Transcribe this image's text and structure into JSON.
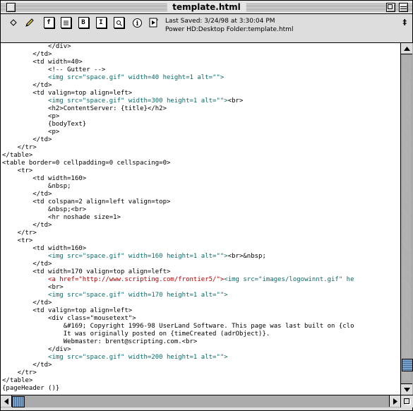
{
  "window": {
    "title": "template.html"
  },
  "toolbar": {
    "icons": [
      "diamond-icon",
      "pencil-icon",
      "function-icon",
      "list-icon",
      "bookmark-icon",
      "indent-icon",
      "find-icon",
      "info-icon",
      "compile-icon"
    ],
    "last_saved": "Last Saved: 3/24/98 at 3:30:04 PM",
    "file_path": "Power HD:Desktop Folder:template.html",
    "right_icon_glyph": "‡"
  },
  "editor": {
    "lines": [
      {
        "segments": [
          {
            "t": "            </div>",
            "c": ""
          }
        ]
      },
      {
        "segments": [
          {
            "t": "        </td>",
            "c": ""
          }
        ]
      },
      {
        "segments": [
          {
            "t": "        <td width=40>",
            "c": ""
          }
        ]
      },
      {
        "segments": [
          {
            "t": "            <!-- Gutter -->",
            "c": ""
          }
        ]
      },
      {
        "segments": [
          {
            "t": "            ",
            "c": ""
          },
          {
            "t": "<img src=\"space.gif\" width=40 height=1 alt=\"\">",
            "c": "teal"
          }
        ]
      },
      {
        "segments": [
          {
            "t": "        </td>",
            "c": ""
          }
        ]
      },
      {
        "segments": [
          {
            "t": "        <td valign=top align=left>",
            "c": ""
          }
        ]
      },
      {
        "segments": [
          {
            "t": "            ",
            "c": ""
          },
          {
            "t": "<img src=\"space.gif\" width=300 height=1 alt=\"\">",
            "c": "teal"
          },
          {
            "t": "<br>",
            "c": ""
          }
        ]
      },
      {
        "segments": [
          {
            "t": "            <h2>ContentServer: {title}</h2>",
            "c": ""
          }
        ]
      },
      {
        "segments": [
          {
            "t": "            <p>",
            "c": ""
          }
        ]
      },
      {
        "segments": [
          {
            "t": "            {bodyText}",
            "c": ""
          }
        ]
      },
      {
        "segments": [
          {
            "t": "            <p>",
            "c": ""
          }
        ]
      },
      {
        "segments": [
          {
            "t": "        </td>",
            "c": ""
          }
        ]
      },
      {
        "segments": [
          {
            "t": "    </tr>",
            "c": ""
          }
        ]
      },
      {
        "segments": [
          {
            "t": "</table>",
            "c": ""
          }
        ]
      },
      {
        "segments": [
          {
            "t": "<table border=0 cellpadding=0 cellspacing=0>",
            "c": ""
          }
        ]
      },
      {
        "segments": [
          {
            "t": "    <tr>",
            "c": ""
          }
        ]
      },
      {
        "segments": [
          {
            "t": "        <td width=160>",
            "c": ""
          }
        ]
      },
      {
        "segments": [
          {
            "t": "            &nbsp;",
            "c": ""
          }
        ]
      },
      {
        "segments": [
          {
            "t": "        </td>",
            "c": ""
          }
        ]
      },
      {
        "segments": [
          {
            "t": "        <td colspan=2 align=left valign=top>",
            "c": ""
          }
        ]
      },
      {
        "segments": [
          {
            "t": "            &nbsp;<br>",
            "c": ""
          }
        ]
      },
      {
        "segments": [
          {
            "t": "            <hr noshade size=1>",
            "c": ""
          }
        ]
      },
      {
        "segments": [
          {
            "t": "        </td>",
            "c": ""
          }
        ]
      },
      {
        "segments": [
          {
            "t": "    </tr>",
            "c": ""
          }
        ]
      },
      {
        "segments": [
          {
            "t": "    <tr>",
            "c": ""
          }
        ]
      },
      {
        "segments": [
          {
            "t": "        <td width=160>",
            "c": ""
          }
        ]
      },
      {
        "segments": [
          {
            "t": "            ",
            "c": ""
          },
          {
            "t": "<img src=\"space.gif\" width=160 height=1 alt=\"\">",
            "c": "teal"
          },
          {
            "t": "<br>&nbsp;",
            "c": ""
          }
        ]
      },
      {
        "segments": [
          {
            "t": "        </td>",
            "c": ""
          }
        ]
      },
      {
        "segments": [
          {
            "t": "        <td width=170 valign=top align=left>",
            "c": ""
          }
        ]
      },
      {
        "segments": [
          {
            "t": "            ",
            "c": ""
          },
          {
            "t": "<a href=\"http://www.scripting.com/frontier5/\">",
            "c": "red"
          },
          {
            "t": "<img src=\"images/logowinnt.gif\" he",
            "c": "teal"
          }
        ]
      },
      {
        "segments": [
          {
            "t": "            <br>",
            "c": ""
          }
        ]
      },
      {
        "segments": [
          {
            "t": "            ",
            "c": ""
          },
          {
            "t": "<img src=\"space.gif\" width=170 height=1 alt=\"\">",
            "c": "teal"
          }
        ]
      },
      {
        "segments": [
          {
            "t": "        </td>",
            "c": ""
          }
        ]
      },
      {
        "segments": [
          {
            "t": "        <td valign=top align=left>",
            "c": ""
          }
        ]
      },
      {
        "segments": [
          {
            "t": "            <div class=\"mousetext\">",
            "c": ""
          }
        ]
      },
      {
        "segments": [
          {
            "t": "                &#169; Copyright 1996-98 UserLand Software. This page was last built on {clo",
            "c": ""
          }
        ]
      },
      {
        "segments": [
          {
            "t": "                It was originally posted on {timeCreated (adrObject)}.",
            "c": ""
          }
        ]
      },
      {
        "segments": [
          {
            "t": "                Webmaster: brent@scripting.com.<br>",
            "c": ""
          }
        ]
      },
      {
        "segments": [
          {
            "t": "            </div>",
            "c": ""
          }
        ]
      },
      {
        "segments": [
          {
            "t": "            ",
            "c": ""
          },
          {
            "t": "<img src=\"space.gif\" width=200 height=1 alt=\"\">",
            "c": "teal"
          }
        ]
      },
      {
        "segments": [
          {
            "t": "        </td>",
            "c": ""
          }
        ]
      },
      {
        "segments": [
          {
            "t": "    </tr>",
            "c": ""
          }
        ]
      },
      {
        "segments": [
          {
            "t": "</table>",
            "c": ""
          }
        ]
      },
      {
        "segments": [
          {
            "t": "{pageHeader ()}",
            "c": ""
          }
        ]
      }
    ]
  },
  "scrollbars": {
    "vertical_position": 0.96,
    "horizontal_position": 0.0
  },
  "colors": {
    "tag_teal": "#0a6a6a",
    "link_red": "#b00000",
    "scroll_thumb": "#7aa0c8"
  }
}
